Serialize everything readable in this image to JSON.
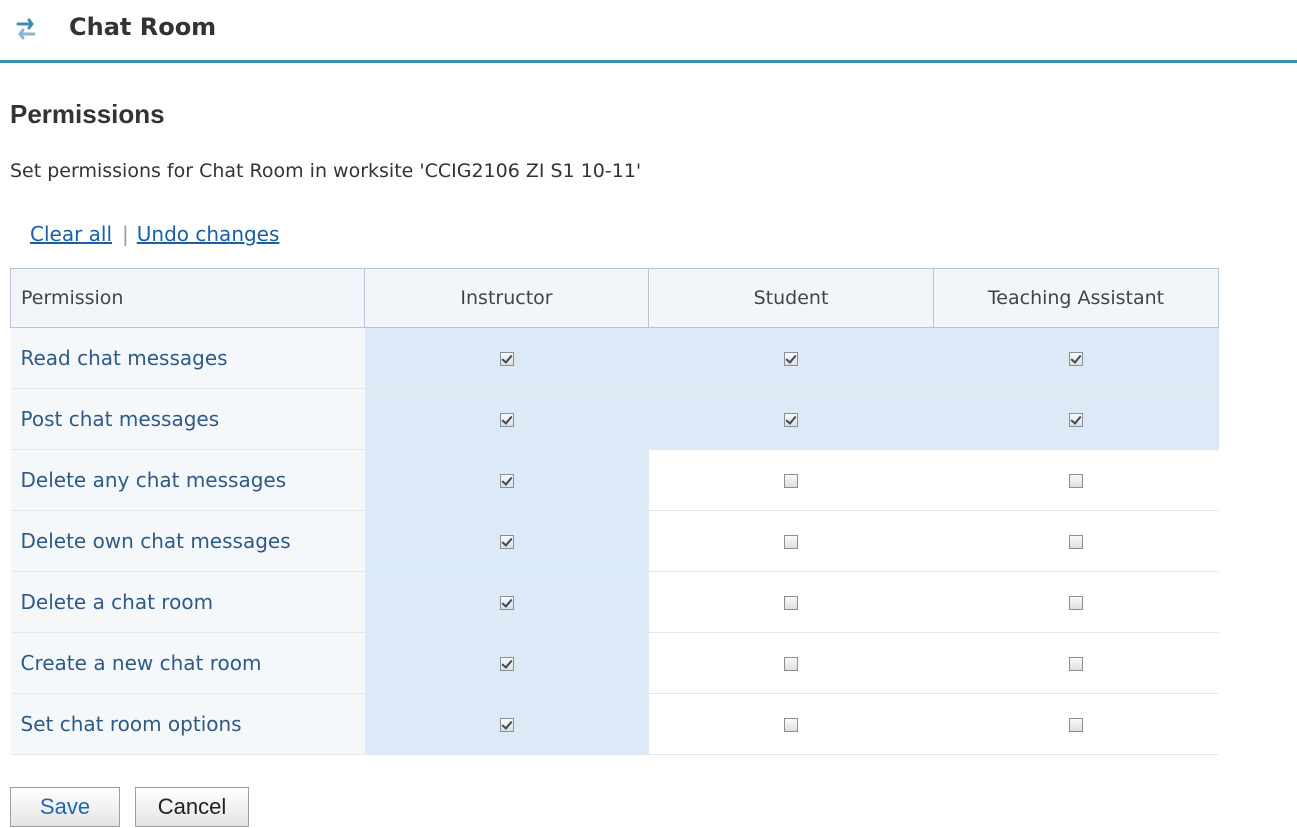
{
  "tool": {
    "title": "Chat Room",
    "icon": "refresh-arrows-icon"
  },
  "page": {
    "heading": "Permissions",
    "instructions": "Set permissions for Chat Room in worksite 'CCIG2106 ZI S1 10-11'"
  },
  "actions": {
    "clear_all": "Clear all",
    "separator": "|",
    "undo": "Undo changes"
  },
  "table": {
    "columns": [
      "Permission",
      "Instructor",
      "Student",
      "Teaching Assistant"
    ],
    "rows": [
      {
        "label": "Read chat messages",
        "values": [
          true,
          true,
          true
        ]
      },
      {
        "label": "Post chat messages",
        "values": [
          true,
          true,
          true
        ]
      },
      {
        "label": "Delete any chat messages",
        "values": [
          true,
          false,
          false
        ]
      },
      {
        "label": "Delete own chat messages",
        "values": [
          true,
          false,
          false
        ]
      },
      {
        "label": "Delete a chat room",
        "values": [
          true,
          false,
          false
        ]
      },
      {
        "label": "Create a new chat room",
        "values": [
          true,
          false,
          false
        ]
      },
      {
        "label": "Set chat room options",
        "values": [
          true,
          false,
          false
        ]
      }
    ]
  },
  "buttons": {
    "save": "Save",
    "cancel": "Cancel"
  },
  "colors": {
    "accent": "#3d8fb0",
    "link": "#1a5fa6",
    "highlight": "#dce9f7"
  }
}
